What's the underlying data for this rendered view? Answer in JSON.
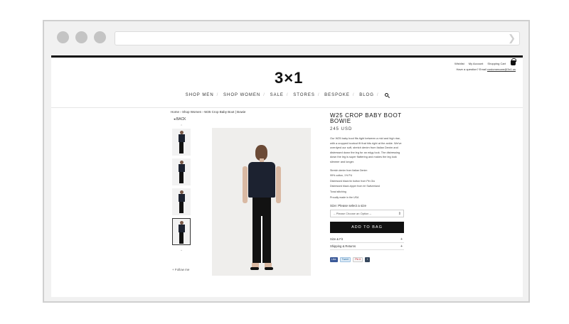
{
  "top_links": [
    "Wishlist",
    "My Account",
    "Shopping Cart"
  ],
  "help_line": {
    "prefix": "Have a question? Email",
    "email": "customercare@3x1.us"
  },
  "logo": "3×1",
  "nav": [
    "SHOP MEN",
    "SHOP WOMEN",
    "SALE",
    "STORES",
    "BESPOKE",
    "BLOG"
  ],
  "breadcrumb": "Home › Shop Women › W25 Crop Baby Boot | Bowie",
  "back_label": "◂ BACK",
  "follow_label": "+ Follow me",
  "product": {
    "title": "W25 CROP BABY BOOT BOWIE",
    "price": "245 USD",
    "description": "Our W25 baby boot fits tight between a mid and high rise, with a cropped bootcut fit that hits right at the ankle. We've overdyed our soft, stretch denim from Italian Denim and distressed down the leg for an edgy look. The distressing down the leg is super flattering and makes the leg look slimmer and longer.",
    "specs": [
      "Stretch denim from Italian Denim",
      "99% cotton, 1% PU",
      "Distressed black tin button from Pin Gio",
      "Distressed black zipper from riri Switzerland",
      "Tonal stitching",
      "Proudly made in the USA"
    ],
    "size_label": "Size: Please select a size",
    "size_select": "-- Please Choose an Option --",
    "add_to_bag": "ADD TO BAG",
    "accordions": [
      "Size & Fit",
      "Shipping & Returns"
    ]
  },
  "social": {
    "like": "Like",
    "tweet": "Tweet",
    "pin": "Pin it",
    "tumblr": "t"
  }
}
